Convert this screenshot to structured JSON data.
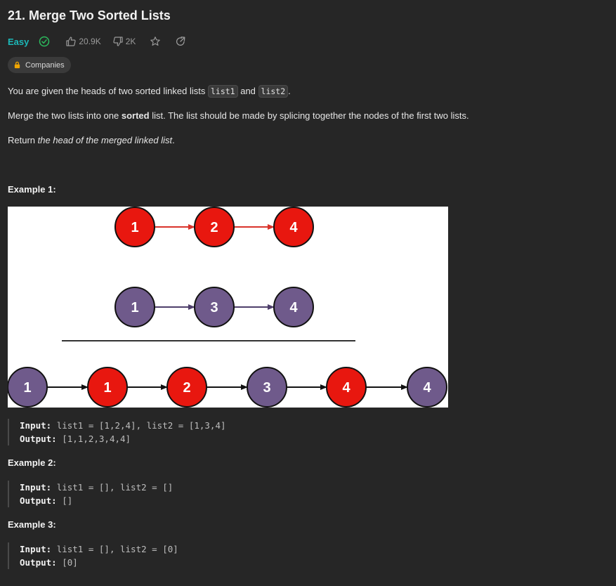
{
  "problem": {
    "title": "21. Merge Two Sorted Lists",
    "difficulty": "Easy",
    "likes": "20.9K",
    "dislikes": "2K",
    "companies_label": "Companies"
  },
  "description": {
    "p1_a": "You are given the heads of two sorted linked lists ",
    "p1_code1": "list1",
    "p1_b": " and ",
    "p1_code2": "list2",
    "p1_c": ".",
    "p2_a": "Merge the two lists into one ",
    "p2_bold": "sorted",
    "p2_b": " list. The list should be made by splicing together the nodes of the first two lists.",
    "p3_a": "Return ",
    "p3_italic": "the head of the merged linked list",
    "p3_b": "."
  },
  "examples": [
    {
      "heading": "Example 1:",
      "input_label": "Input:",
      "input": "list1 = [1,2,4], list2 = [1,3,4]",
      "output_label": "Output:",
      "output": "[1,1,2,3,4,4]"
    },
    {
      "heading": "Example 2:",
      "input_label": "Input:",
      "input": "list1 = [], list2 = []",
      "output_label": "Output:",
      "output": "[]"
    },
    {
      "heading": "Example 3:",
      "input_label": "Input:",
      "input": "list1 = [], list2 = [0]",
      "output_label": "Output:",
      "output": "[0]"
    }
  ],
  "figure": {
    "list1": [
      "1",
      "2",
      "4"
    ],
    "list2": [
      "1",
      "3",
      "4"
    ],
    "merged": [
      "1",
      "1",
      "2",
      "3",
      "4",
      "4"
    ],
    "merged_colors": [
      "purple",
      "red",
      "red",
      "purple",
      "red",
      "purple"
    ],
    "colors": {
      "red": "#e8170f",
      "purple": "#6f5a8b",
      "red_arrow": "#d9332b",
      "purple_arrow": "#4f3f6b"
    }
  },
  "colors": {
    "accent_easy": "#1cb8b8",
    "background": "#262626"
  }
}
